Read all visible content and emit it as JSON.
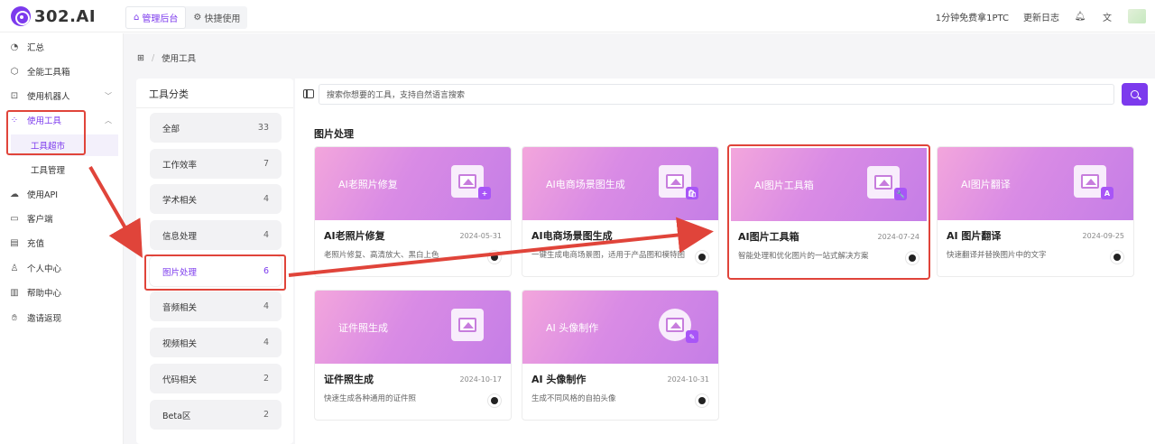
{
  "app": {
    "logo_text": "302.AI"
  },
  "topnav": [
    {
      "label": "管理后台",
      "active": true,
      "icon": "home-icon"
    },
    {
      "label": "快捷使用",
      "active": false,
      "icon": "gear-icon"
    }
  ],
  "topright": {
    "promo": "1分钟免费拿1PTC",
    "changelog": "更新日志"
  },
  "sidebar": {
    "items": [
      {
        "label": "汇总",
        "icon": "dashboard-icon"
      },
      {
        "label": "全能工具箱",
        "icon": "cube-icon"
      },
      {
        "label": "使用机器人",
        "icon": "robot-icon"
      },
      {
        "label": "使用工具",
        "icon": "apps-icon",
        "active": true
      },
      {
        "label": "使用API",
        "icon": "cloud-icon"
      },
      {
        "label": "客户端",
        "icon": "monitor-icon"
      },
      {
        "label": "充值",
        "icon": "wallet-icon"
      },
      {
        "label": "个人中心",
        "icon": "user-icon"
      },
      {
        "label": "帮助中心",
        "icon": "book-icon"
      },
      {
        "label": "邀请返现",
        "icon": "gift-icon"
      }
    ],
    "subitems": [
      {
        "label": "工具超市",
        "active": true
      },
      {
        "label": "工具管理",
        "active": false
      }
    ]
  },
  "breadcrumb": {
    "current": "使用工具"
  },
  "categories": {
    "title": "工具分类",
    "items": [
      {
        "label": "全部",
        "count": "33"
      },
      {
        "label": "工作效率",
        "count": "7"
      },
      {
        "label": "学术相关",
        "count": "4"
      },
      {
        "label": "信息处理",
        "count": "4"
      },
      {
        "label": "图片处理",
        "count": "6",
        "active": true
      },
      {
        "label": "音频相关",
        "count": "4"
      },
      {
        "label": "视频相关",
        "count": "4"
      },
      {
        "label": "代码相关",
        "count": "2"
      },
      {
        "label": "Beta区",
        "count": "2"
      }
    ]
  },
  "search": {
    "placeholder": "搜索你想要的工具，支持自然语言搜索"
  },
  "section": {
    "title": "图片处理"
  },
  "tools": [
    {
      "banner": "AI老照片修复",
      "name": "AI老照片修复",
      "date": "2024-05-31",
      "desc": "老照片修复、高清放大、黑白上色",
      "badge": "+"
    },
    {
      "banner": "AI电商场景图生成",
      "name": "AI电商场景图生成",
      "date": "",
      "desc": "一键生成电商场景图，适用于产品图和模特图",
      "badge": "🛍"
    },
    {
      "banner": "AI图片工具箱",
      "name": "AI图片工具箱",
      "date": "2024-07-24",
      "desc": "智能处理和优化图片的一站式解决方案",
      "badge": "🔧"
    },
    {
      "banner": "AI图片翻译",
      "name": "AI 图片翻译",
      "date": "2024-09-25",
      "desc": "快速翻译并替换图片中的文字",
      "badge": "A"
    },
    {
      "banner": "证件照生成",
      "name": "证件照生成",
      "date": "2024-10-17",
      "desc": "快速生成各种通用的证件照",
      "badge": ""
    },
    {
      "banner": "AI 头像制作",
      "name": "AI 头像制作",
      "date": "2024-10-31",
      "desc": "生成不同风格的自拍头像",
      "badge": "✎"
    }
  ]
}
